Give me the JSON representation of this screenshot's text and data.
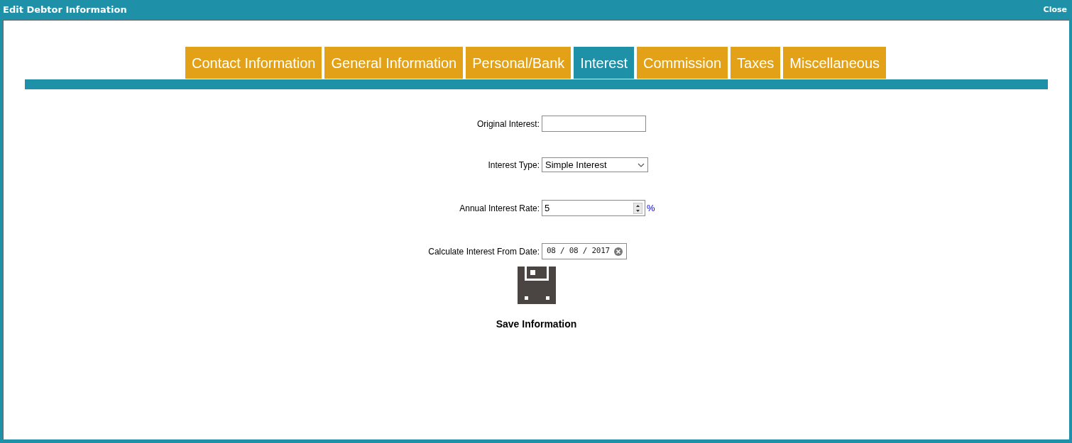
{
  "window": {
    "title": "Edit Debtor Information",
    "close": "Close"
  },
  "tabs": [
    {
      "label": "Contact Information",
      "selected": false
    },
    {
      "label": "General Information",
      "selected": false
    },
    {
      "label": "Personal/Bank",
      "selected": false
    },
    {
      "label": "Interest",
      "selected": true
    },
    {
      "label": "Commission",
      "selected": false
    },
    {
      "label": "Taxes",
      "selected": false
    },
    {
      "label": "Miscellaneous",
      "selected": false
    }
  ],
  "fields": [
    {
      "kind": "text",
      "label": "Original Interest:"
    },
    {
      "kind": "select",
      "label": "Interest Type:",
      "value": "Simple Interest"
    },
    {
      "kind": "number",
      "label": "Annual Interest Rate:",
      "value": "5",
      "unit": "%"
    },
    {
      "kind": "date",
      "label": "Calculate Interest From Date:",
      "value": "08 / 08 / 2017"
    }
  ],
  "save": {
    "label": "Save Information"
  }
}
